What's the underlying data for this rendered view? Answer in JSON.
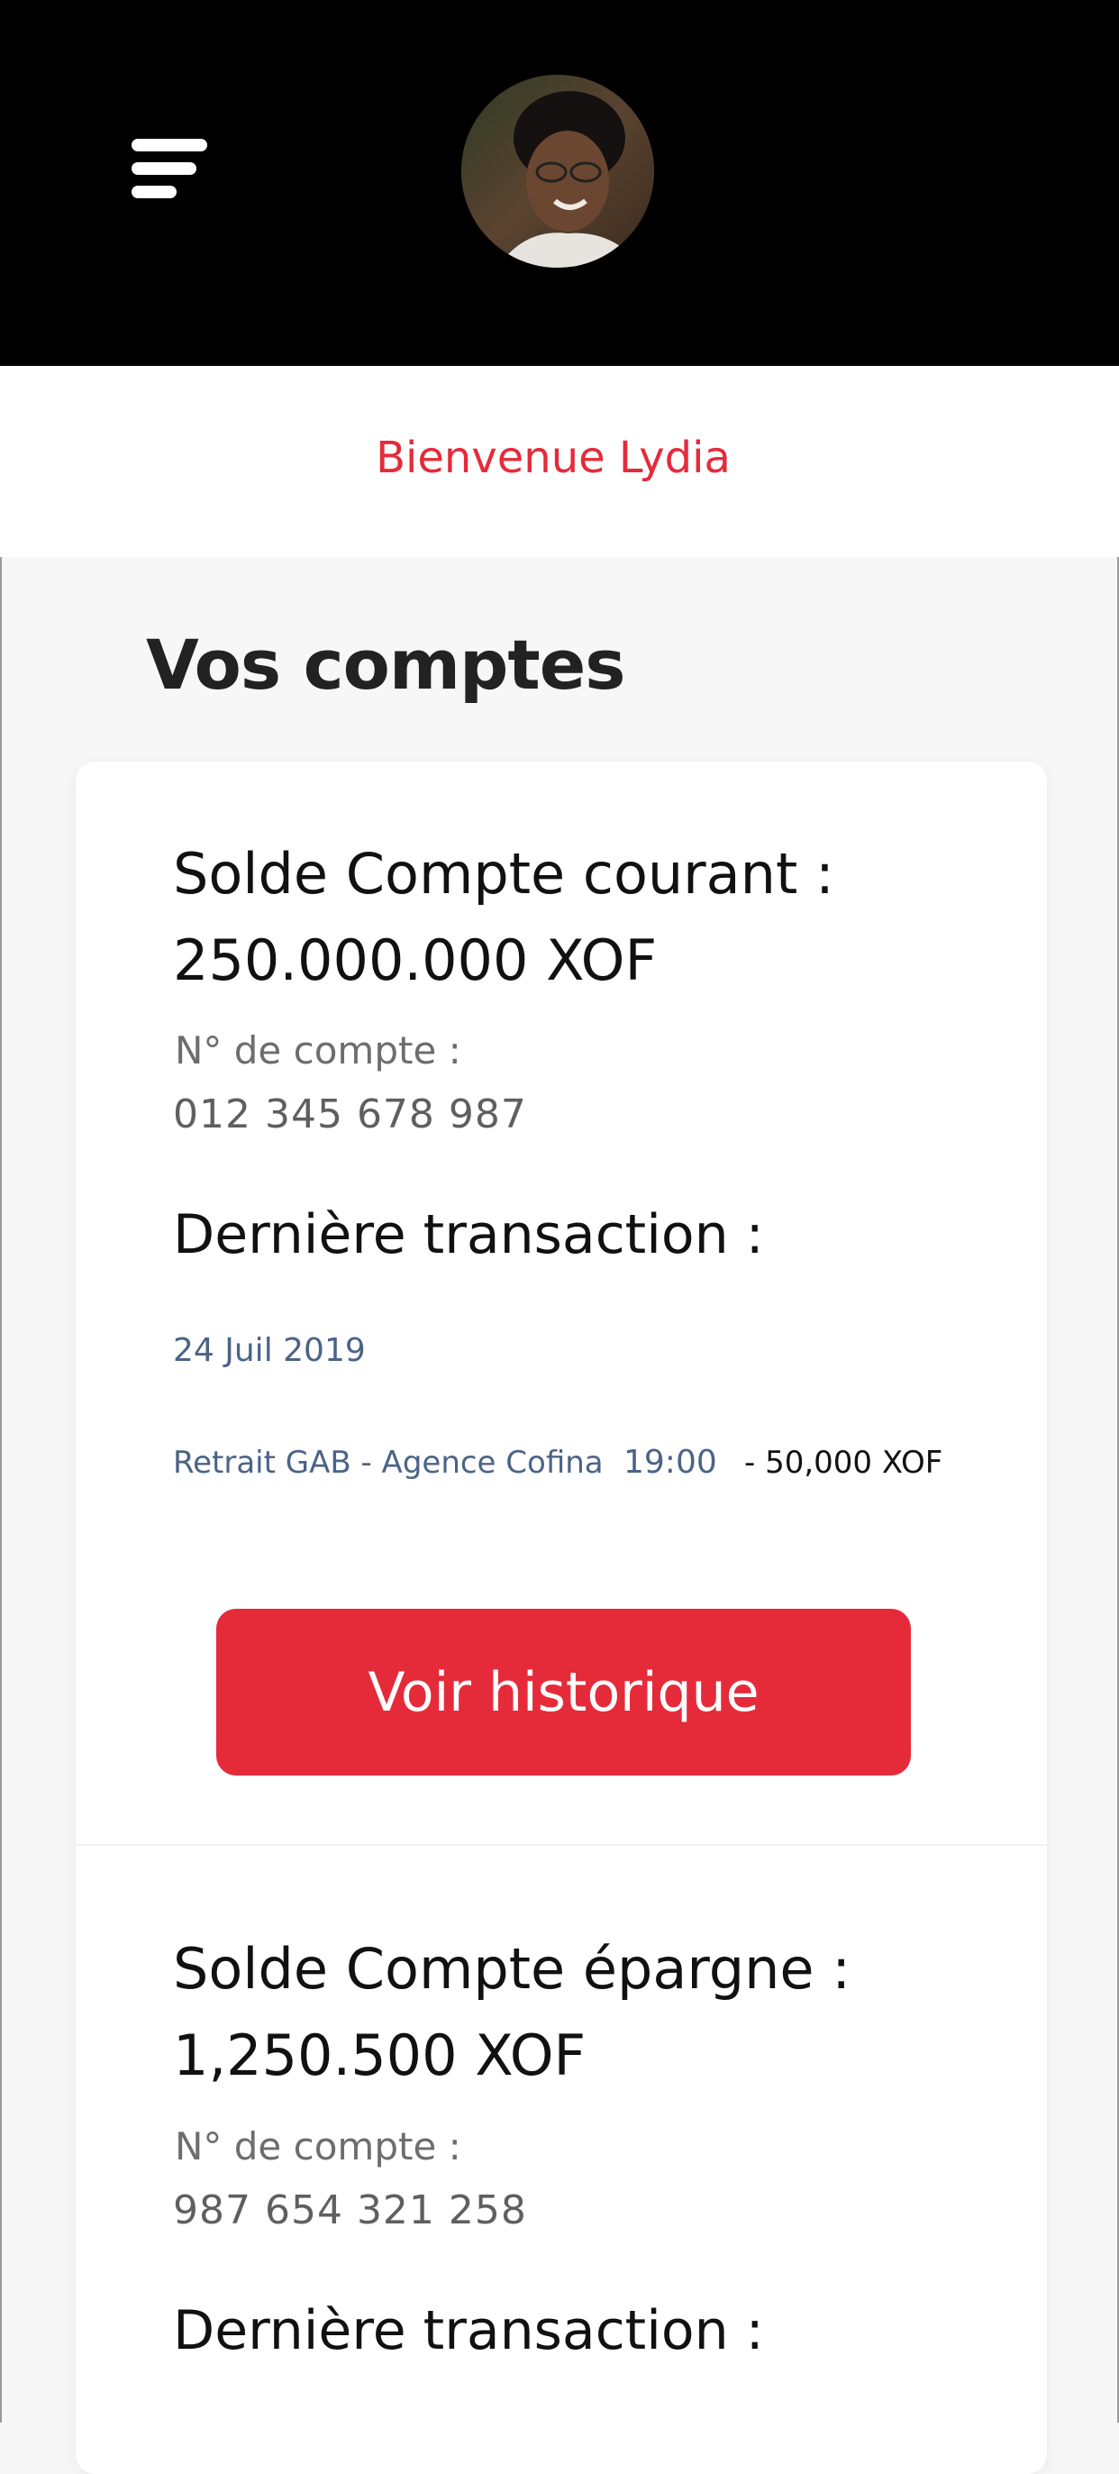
{
  "header": {
    "background": "#000000",
    "menu_icon": "hamburger-menu-icon",
    "avatar_alt": "Lydia profile photo"
  },
  "welcome": {
    "text": "Bienvenue Lydia",
    "color": "#e52b3a"
  },
  "accounts": {
    "title": "Vos comptes",
    "items": [
      {
        "balance_label": "Solde Compte courant :",
        "balance": "250.000.000 XOF",
        "account_number_label": "N° de compte :",
        "account_number": "012 345 678 987",
        "last_transaction_label": "Dernière transaction :",
        "last_transaction": {
          "date": "24 Juil 2019",
          "description": "Retrait GAB - Agence Cofina",
          "time": "19:00",
          "amount": "- 50,000 XOF"
        },
        "history_button": "Voir historique"
      },
      {
        "balance_label": "Solde Compte épargne :",
        "balance": "1,250.500 XOF",
        "account_number_label": "N° de compte :",
        "account_number": "987 654 321 258",
        "last_transaction_label": "Dernière transaction :"
      }
    ]
  },
  "colors": {
    "accent": "#e52b3a",
    "muted_blue": "#4b6387",
    "card": "#ffffff",
    "page": "#f7f7f7"
  }
}
